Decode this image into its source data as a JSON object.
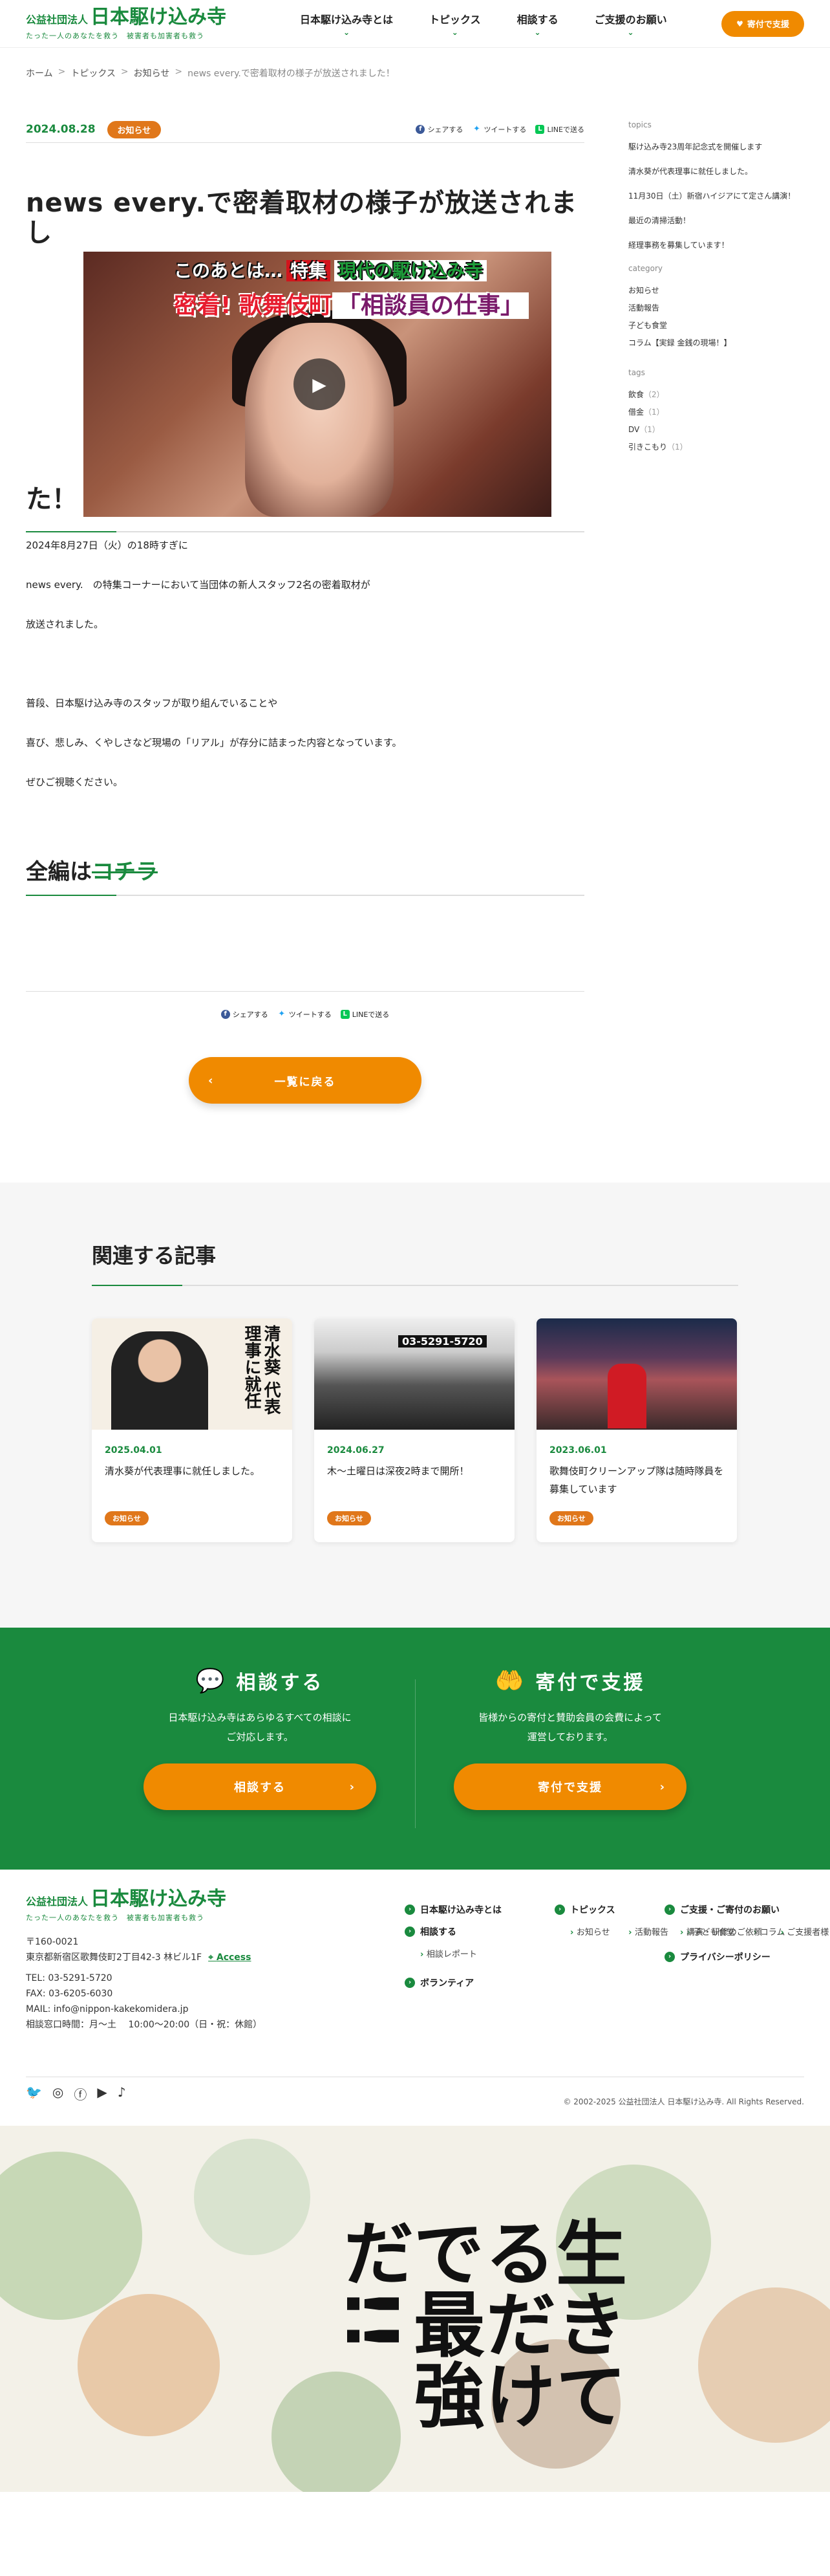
{
  "header": {
    "logo_small": "公益社団法人",
    "logo_main": "日本駆け込み寺",
    "logo_sub": "たった一人のあなたを救う　被害者も加害者も救う",
    "nav": [
      {
        "label": "日本駆け込み寺とは"
      },
      {
        "label": "トピックス"
      },
      {
        "label": "相談する"
      },
      {
        "label": "ご支援のお願い"
      }
    ],
    "donate_label": "寄付で支援"
  },
  "breadcrumb": [
    "ホーム",
    "トピックス",
    "お知らせ",
    "news every.で密着取材の様子が放送されました！"
  ],
  "article": {
    "date": "2024.08.28",
    "category": "お知らせ",
    "share": {
      "facebook": "シェアする",
      "twitter": "ツイートする",
      "line": "LINEで送る"
    },
    "title": "news every.で密着取材の様子が放送されまし",
    "title_tail": "た！",
    "video": {
      "banner_top_a": "このあとは…",
      "banner_top_tag": "特集",
      "banner_top_b": "現代の駆け込み寺",
      "banner_bottom_a": "密着! 歌舞伎町",
      "banner_bottom_b": "「相談員の仕事」"
    },
    "paragraphs": [
      "2024年8月27日（火）の18時すぎに",
      "news every.　の特集コーナーにおいて当団体の新人スタッフ2名の密着取材が",
      "放送されました。",
      "普段、日本駆け込み寺のスタッフが取り組んでいることや",
      "喜び、悲しみ、くやしさなど現場の「リアル」が存分に詰まった内容となっています。",
      "ぜひご視聴ください。"
    ],
    "zenpen_a": "全編は",
    "zenpen_b": "コチラ",
    "back_label": "一覧に戻る"
  },
  "sidebar": {
    "topics_heading": "topics",
    "topics": [
      "駆け込み寺23周年記念式を開催します",
      "清水葵が代表理事に就任しました。",
      "11月30日（土）新宿ハイジアにて定さん講演！",
      "最近の清掃活動！",
      "経理事務を募集しています！"
    ],
    "category_heading": "category",
    "categories": [
      "お知らせ",
      "活動報告",
      "子ども食堂",
      "コラム【実録 金銭の現場！】"
    ],
    "tags_heading": "tags",
    "tags": [
      {
        "name": "飲食",
        "count": "（2）"
      },
      {
        "name": "借金",
        "count": "（1）"
      },
      {
        "name": "DV",
        "count": "（1）"
      },
      {
        "name": "引きこもり",
        "count": "（1）"
      }
    ]
  },
  "related": {
    "heading": "関連する記事",
    "cards": [
      {
        "date": "2025.04.01",
        "title": "清水葵が代表理事に就任しました。",
        "badge": "お知らせ",
        "thumb_text": "清水葵 代表理事に就任"
      },
      {
        "date": "2024.06.27",
        "title": "木～土曜日は深夜2時まで開所！",
        "badge": "お知らせ",
        "thumb_text": "03-5291-5720"
      },
      {
        "date": "2023.06.01",
        "title": "歌舞伎町クリーンアップ隊は随時隊員を募集しています",
        "badge": "お知らせ"
      }
    ]
  },
  "cta": {
    "consult_heading": "相談する",
    "consult_text_1": "日本駆け込み寺はあらゆるすべての相談に",
    "consult_text_2": "ご対応します。",
    "consult_btn": "相談する",
    "donate_heading": "寄付で支援",
    "donate_text_1": "皆様からの寄付と賛助会員の会費によって",
    "donate_text_2": "運営しております。",
    "donate_btn": "寄付で支援"
  },
  "footer": {
    "postal": "〒160-0021",
    "address": "東京都新宿区歌舞伎町2丁目42-3 林ビル1F",
    "access": "Access",
    "tel": "TEL: 03-5291-5720",
    "fax": "FAX: 03-6205-6030",
    "mail": "MAIL: info@nippon-kakekomidera.jp",
    "hours": "相談窓口時間：月～土　 10:00～20:00（日・祝：休館）",
    "nav_col1": [
      {
        "label": "日本駆け込み寺とは",
        "sub": []
      },
      {
        "label": "相談する",
        "sub": [
          "相談レポート"
        ]
      },
      {
        "label": "ボランティア",
        "sub": []
      }
    ],
    "nav_col2": {
      "label": "トピックス",
      "sub": [
        "お知らせ",
        "活動報告",
        "子ども食堂",
        "コラム"
      ]
    },
    "nav_col3": [
      {
        "label": "ご支援・ご寄付のお願い",
        "sub": [
          "講演・研修のご依頼",
          "ご支援者様"
        ]
      },
      {
        "label": "プライバシーポリシー",
        "sub": []
      }
    ],
    "copyright": "© 2002-2025 公益社団法人 日本駆け込み寺. All Rights Reserved."
  },
  "illustration": {
    "text": "生きてるだけで最強だ!!"
  }
}
